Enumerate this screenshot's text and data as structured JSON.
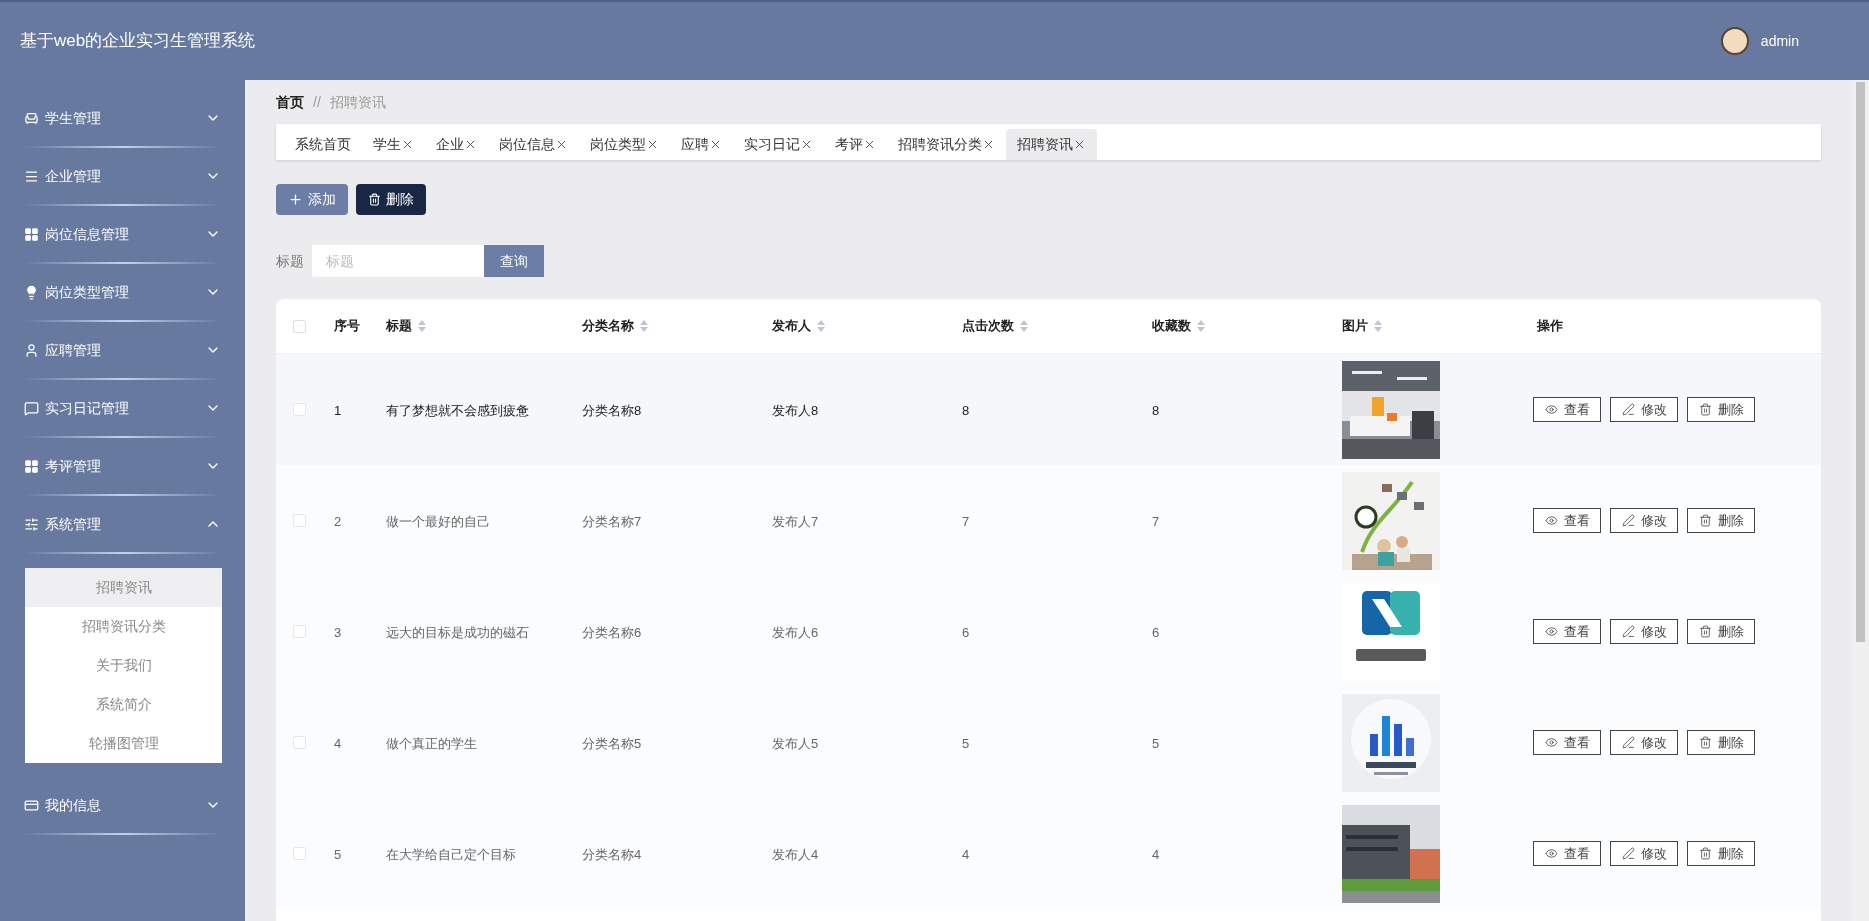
{
  "header": {
    "title": "基于web的企业实习生管理系统",
    "user": "admin"
  },
  "sidebar": {
    "items": [
      {
        "label": "学生管理",
        "expanded": false
      },
      {
        "label": "企业管理",
        "expanded": false
      },
      {
        "label": "岗位信息管理",
        "expanded": false
      },
      {
        "label": "岗位类型管理",
        "expanded": false
      },
      {
        "label": "应聘管理",
        "expanded": false
      },
      {
        "label": "实习日记管理",
        "expanded": false
      },
      {
        "label": "考评管理",
        "expanded": false
      },
      {
        "label": "系统管理",
        "expanded": true,
        "children": [
          {
            "label": "招聘资讯",
            "selected": true
          },
          {
            "label": "招聘资讯分类",
            "selected": false
          },
          {
            "label": "关于我们",
            "selected": false
          },
          {
            "label": "系统简介",
            "selected": false
          },
          {
            "label": "轮播图管理",
            "selected": false
          }
        ]
      },
      {
        "label": "我的信息",
        "expanded": false
      }
    ]
  },
  "breadcrumb": [
    "首页",
    "//",
    "招聘资讯"
  ],
  "tabs": [
    {
      "label": "系统首页",
      "closable": false,
      "selected": false
    },
    {
      "label": "学生",
      "closable": true,
      "selected": false
    },
    {
      "label": "企业",
      "closable": true,
      "selected": false
    },
    {
      "label": "岗位信息",
      "closable": true,
      "selected": false
    },
    {
      "label": "岗位类型",
      "closable": true,
      "selected": false
    },
    {
      "label": "应聘",
      "closable": true,
      "selected": false
    },
    {
      "label": "实习日记",
      "closable": true,
      "selected": false
    },
    {
      "label": "考评",
      "closable": true,
      "selected": false
    },
    {
      "label": "招聘资讯分类",
      "closable": true,
      "selected": false
    },
    {
      "label": "招聘资讯",
      "closable": true,
      "selected": true
    }
  ],
  "toolbar": [
    {
      "label": "添加",
      "kind": "add"
    },
    {
      "label": "删除",
      "kind": "delete"
    }
  ],
  "search": {
    "label": "标题",
    "placeholder": "标题",
    "button": "查询"
  },
  "table": {
    "select_all_checked": false,
    "columns": [
      {
        "label": "序号",
        "sortable": false
      },
      {
        "label": "标题",
        "sortable": true
      },
      {
        "label": "分类名称",
        "sortable": true
      },
      {
        "label": "发布人",
        "sortable": true
      },
      {
        "label": "点击次数",
        "sortable": true
      },
      {
        "label": "收藏数",
        "sortable": true
      },
      {
        "label": "图片",
        "sortable": true
      },
      {
        "label": "操作",
        "sortable": false
      }
    ],
    "rows": [
      {
        "checked": false,
        "hovered": true,
        "cells": [
          "1",
          "有了梦想就不会感到疲惫",
          "分类名称8",
          "发布人8",
          "8",
          "8"
        ],
        "actions": [
          {
            "label": "查看",
            "kind": "view"
          },
          {
            "label": "修改",
            "kind": "edit"
          },
          {
            "label": "删除",
            "kind": "delete"
          }
        ]
      },
      {
        "checked": false,
        "hovered": false,
        "cells": [
          "2",
          "做一个最好的自己",
          "分类名称7",
          "发布人7",
          "7",
          "7"
        ],
        "actions": [
          {
            "label": "查看",
            "kind": "view"
          },
          {
            "label": "修改",
            "kind": "edit"
          },
          {
            "label": "删除",
            "kind": "delete"
          }
        ]
      },
      {
        "checked": false,
        "hovered": false,
        "cells": [
          "3",
          "远大的目标是成功的磁石",
          "分类名称6",
          "发布人6",
          "6",
          "6"
        ],
        "actions": [
          {
            "label": "查看",
            "kind": "view"
          },
          {
            "label": "修改",
            "kind": "edit"
          },
          {
            "label": "删除",
            "kind": "delete"
          }
        ]
      },
      {
        "checked": false,
        "hovered": false,
        "cells": [
          "4",
          "做个真正的学生",
          "分类名称5",
          "发布人5",
          "5",
          "5"
        ],
        "actions": [
          {
            "label": "查看",
            "kind": "view"
          },
          {
            "label": "修改",
            "kind": "edit"
          },
          {
            "label": "删除",
            "kind": "delete"
          }
        ]
      },
      {
        "checked": false,
        "hovered": false,
        "cells": [
          "5",
          "在大学给自己定个目标",
          "分类名称4",
          "发布人4",
          "4",
          "4"
        ],
        "actions": [
          {
            "label": "查看",
            "kind": "view"
          },
          {
            "label": "修改",
            "kind": "edit"
          },
          {
            "label": "删除",
            "kind": "delete"
          }
        ]
      }
    ]
  }
}
